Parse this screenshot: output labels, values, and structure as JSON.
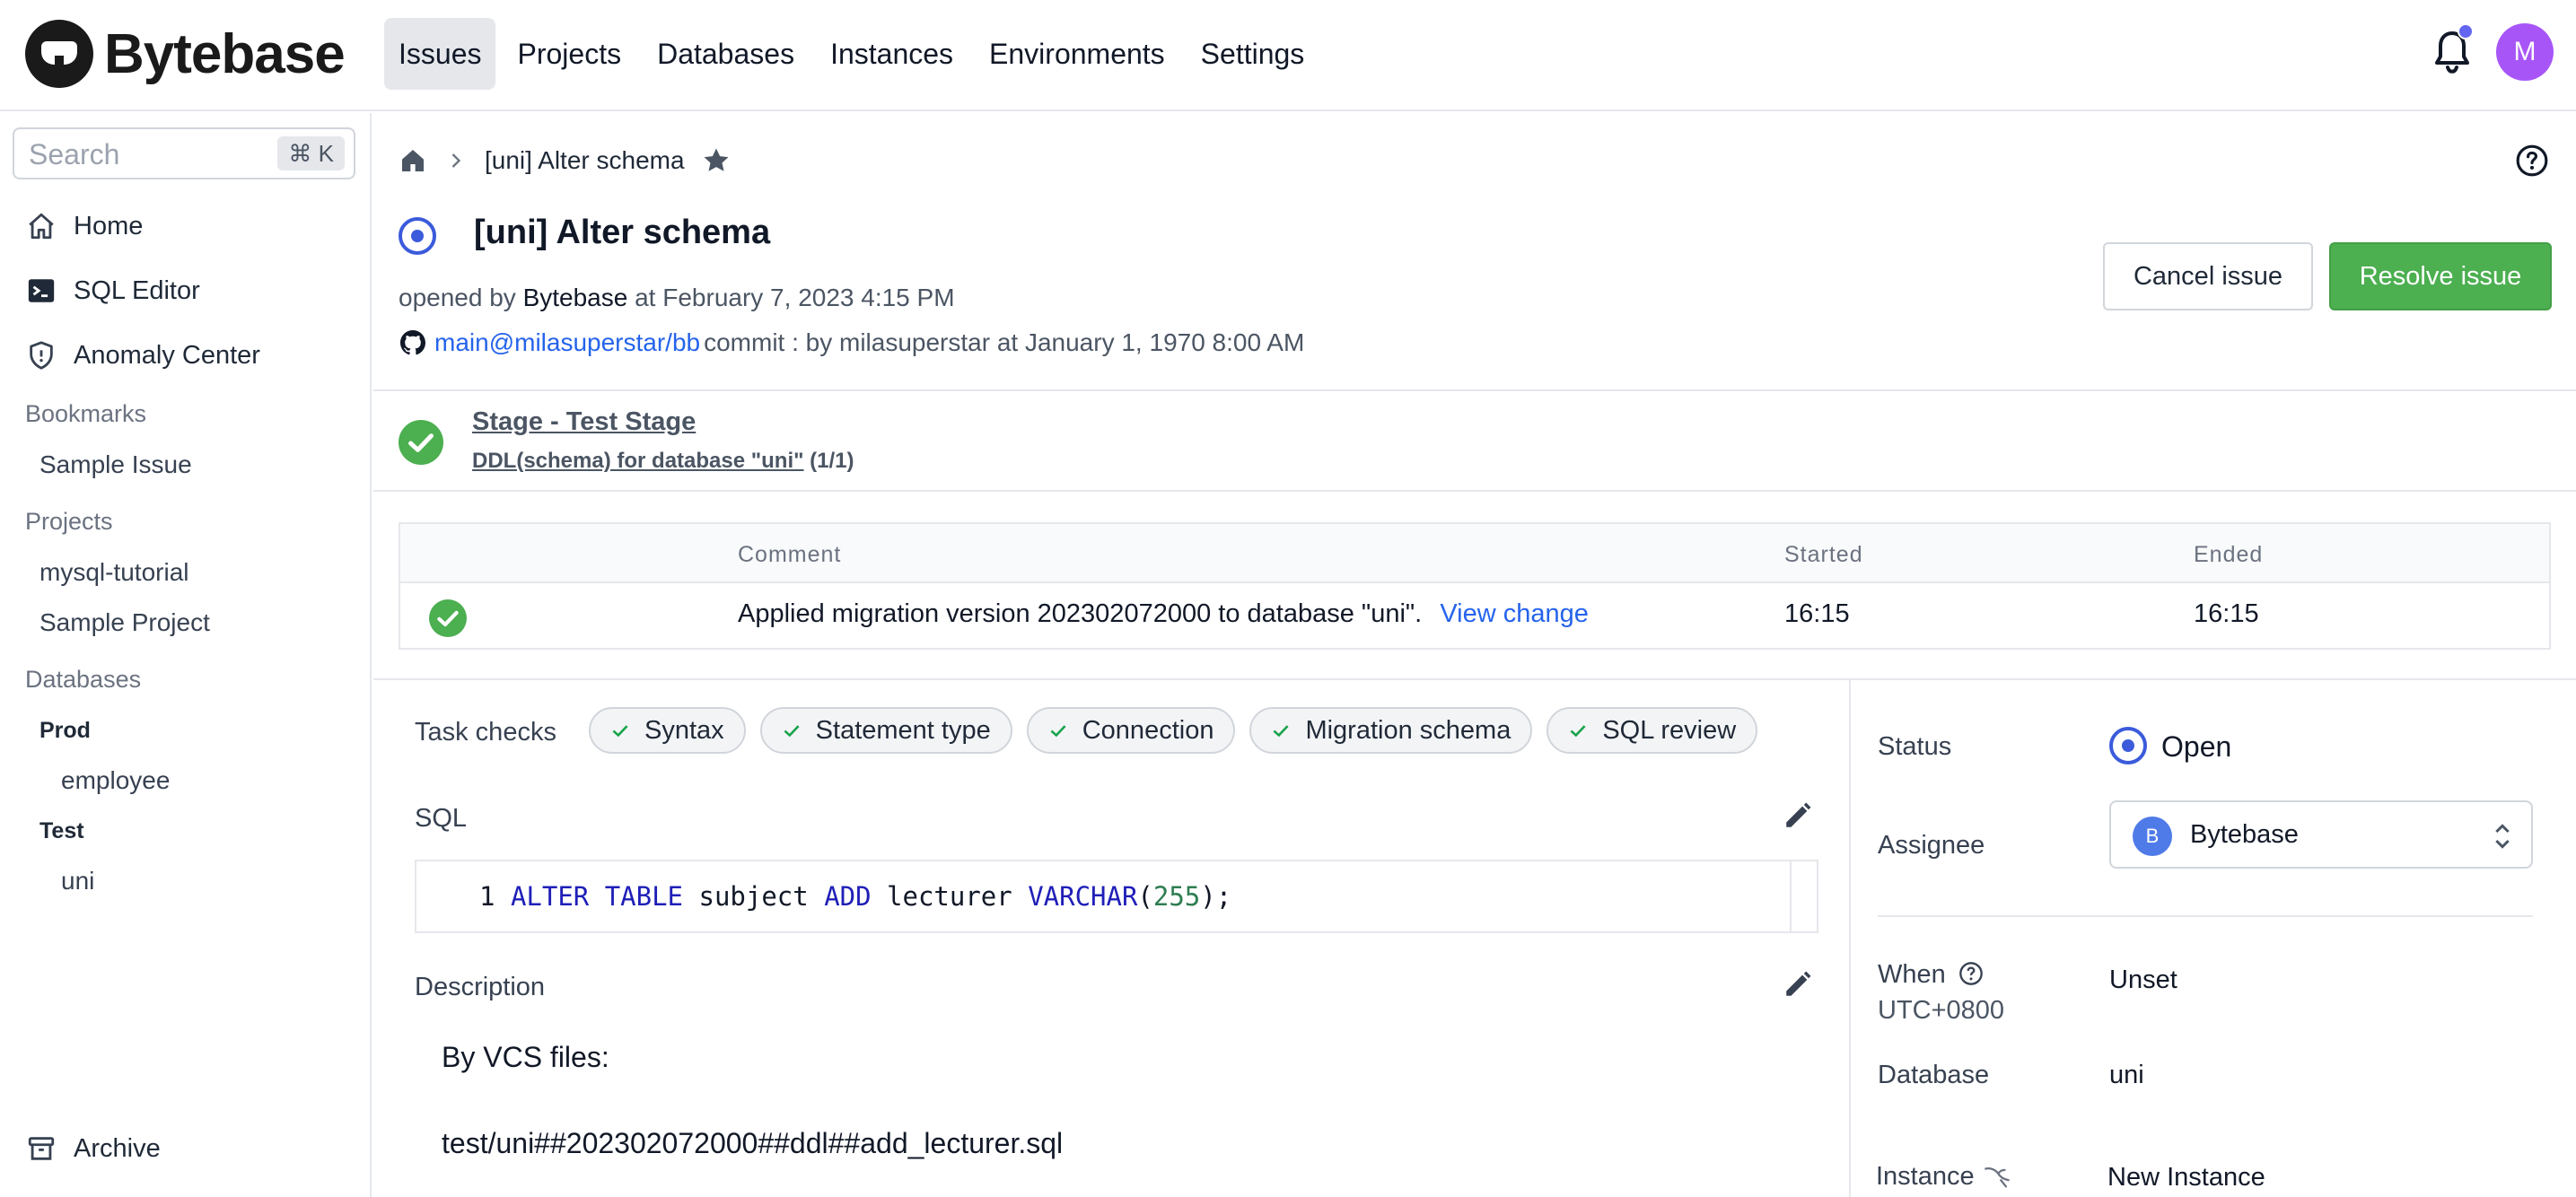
{
  "app": {
    "name": "Bytebase"
  },
  "nav": {
    "items": [
      {
        "label": "Issues",
        "active": true
      },
      {
        "label": "Projects"
      },
      {
        "label": "Databases"
      },
      {
        "label": "Instances"
      },
      {
        "label": "Environments"
      },
      {
        "label": "Settings"
      }
    ]
  },
  "user": {
    "initial": "M",
    "color": "#a855f7"
  },
  "sidebar": {
    "search_placeholder": "Search",
    "search_shortcut": "⌘ K",
    "links": [
      {
        "label": "Home",
        "icon": "home-icon"
      },
      {
        "label": "SQL Editor",
        "icon": "terminal-icon"
      },
      {
        "label": "Anomaly Center",
        "icon": "shield-icon"
      }
    ],
    "bookmarks_heading": "Bookmarks",
    "bookmarks": [
      "Sample Issue"
    ],
    "projects_heading": "Projects",
    "projects": [
      "mysql-tutorial",
      "Sample Project"
    ],
    "databases_heading": "Databases",
    "environments": [
      {
        "name": "Prod",
        "databases": [
          "employee"
        ]
      },
      {
        "name": "Test",
        "databases": [
          "uni"
        ]
      }
    ],
    "archive_label": "Archive"
  },
  "breadcrumb": {
    "current": "[uni] Alter schema"
  },
  "issue": {
    "title": "[uni] Alter schema",
    "opened_prefix": "opened by",
    "creator": "Bytebase",
    "opened_at": "at February 7, 2023 4:15 PM",
    "vcs_branch": "main@milasuperstar/bb",
    "vcs_commit": "commit : by milasuperstar at January 1, 1970 8:00 AM"
  },
  "actions": {
    "cancel": "Cancel issue",
    "resolve": "Resolve issue"
  },
  "stage": {
    "title": "Stage - Test Stage",
    "task": "DDL(schema) for database \"uni\"",
    "progress": "(1/1)"
  },
  "task_table": {
    "headers": {
      "comment": "Comment",
      "started": "Started",
      "ended": "Ended"
    },
    "rows": [
      {
        "comment": "Applied migration version 202302072000 to database \"uni\".",
        "link": "View change",
        "started": "16:15",
        "ended": "16:15"
      }
    ]
  },
  "task_checks": {
    "label": "Task checks",
    "items": [
      "Syntax",
      "Statement type",
      "Connection",
      "Migration schema",
      "SQL review"
    ]
  },
  "sql": {
    "label": "SQL",
    "line_number": "1",
    "tokens": {
      "t1": "ALTER",
      "t2": "TABLE",
      "t3": "subject",
      "t4": "ADD",
      "t5": "lecturer",
      "t6": "VARCHAR",
      "t7": "(",
      "t8": "255",
      "t9": ");"
    }
  },
  "description": {
    "label": "Description",
    "line1": "By VCS files:",
    "line2": "test/uni##202302072000##ddl##add_lecturer.sql"
  },
  "details": {
    "status_label": "Status",
    "status_value": "Open",
    "assignee_label": "Assignee",
    "assignee_initial": "B",
    "assignee_name": "Bytebase",
    "when_label": "When",
    "when_tz": "UTC+0800",
    "when_value": "Unset",
    "database_label": "Database",
    "database_value": "uni",
    "instance_label": "Instance",
    "instance_value": "New Instance"
  }
}
